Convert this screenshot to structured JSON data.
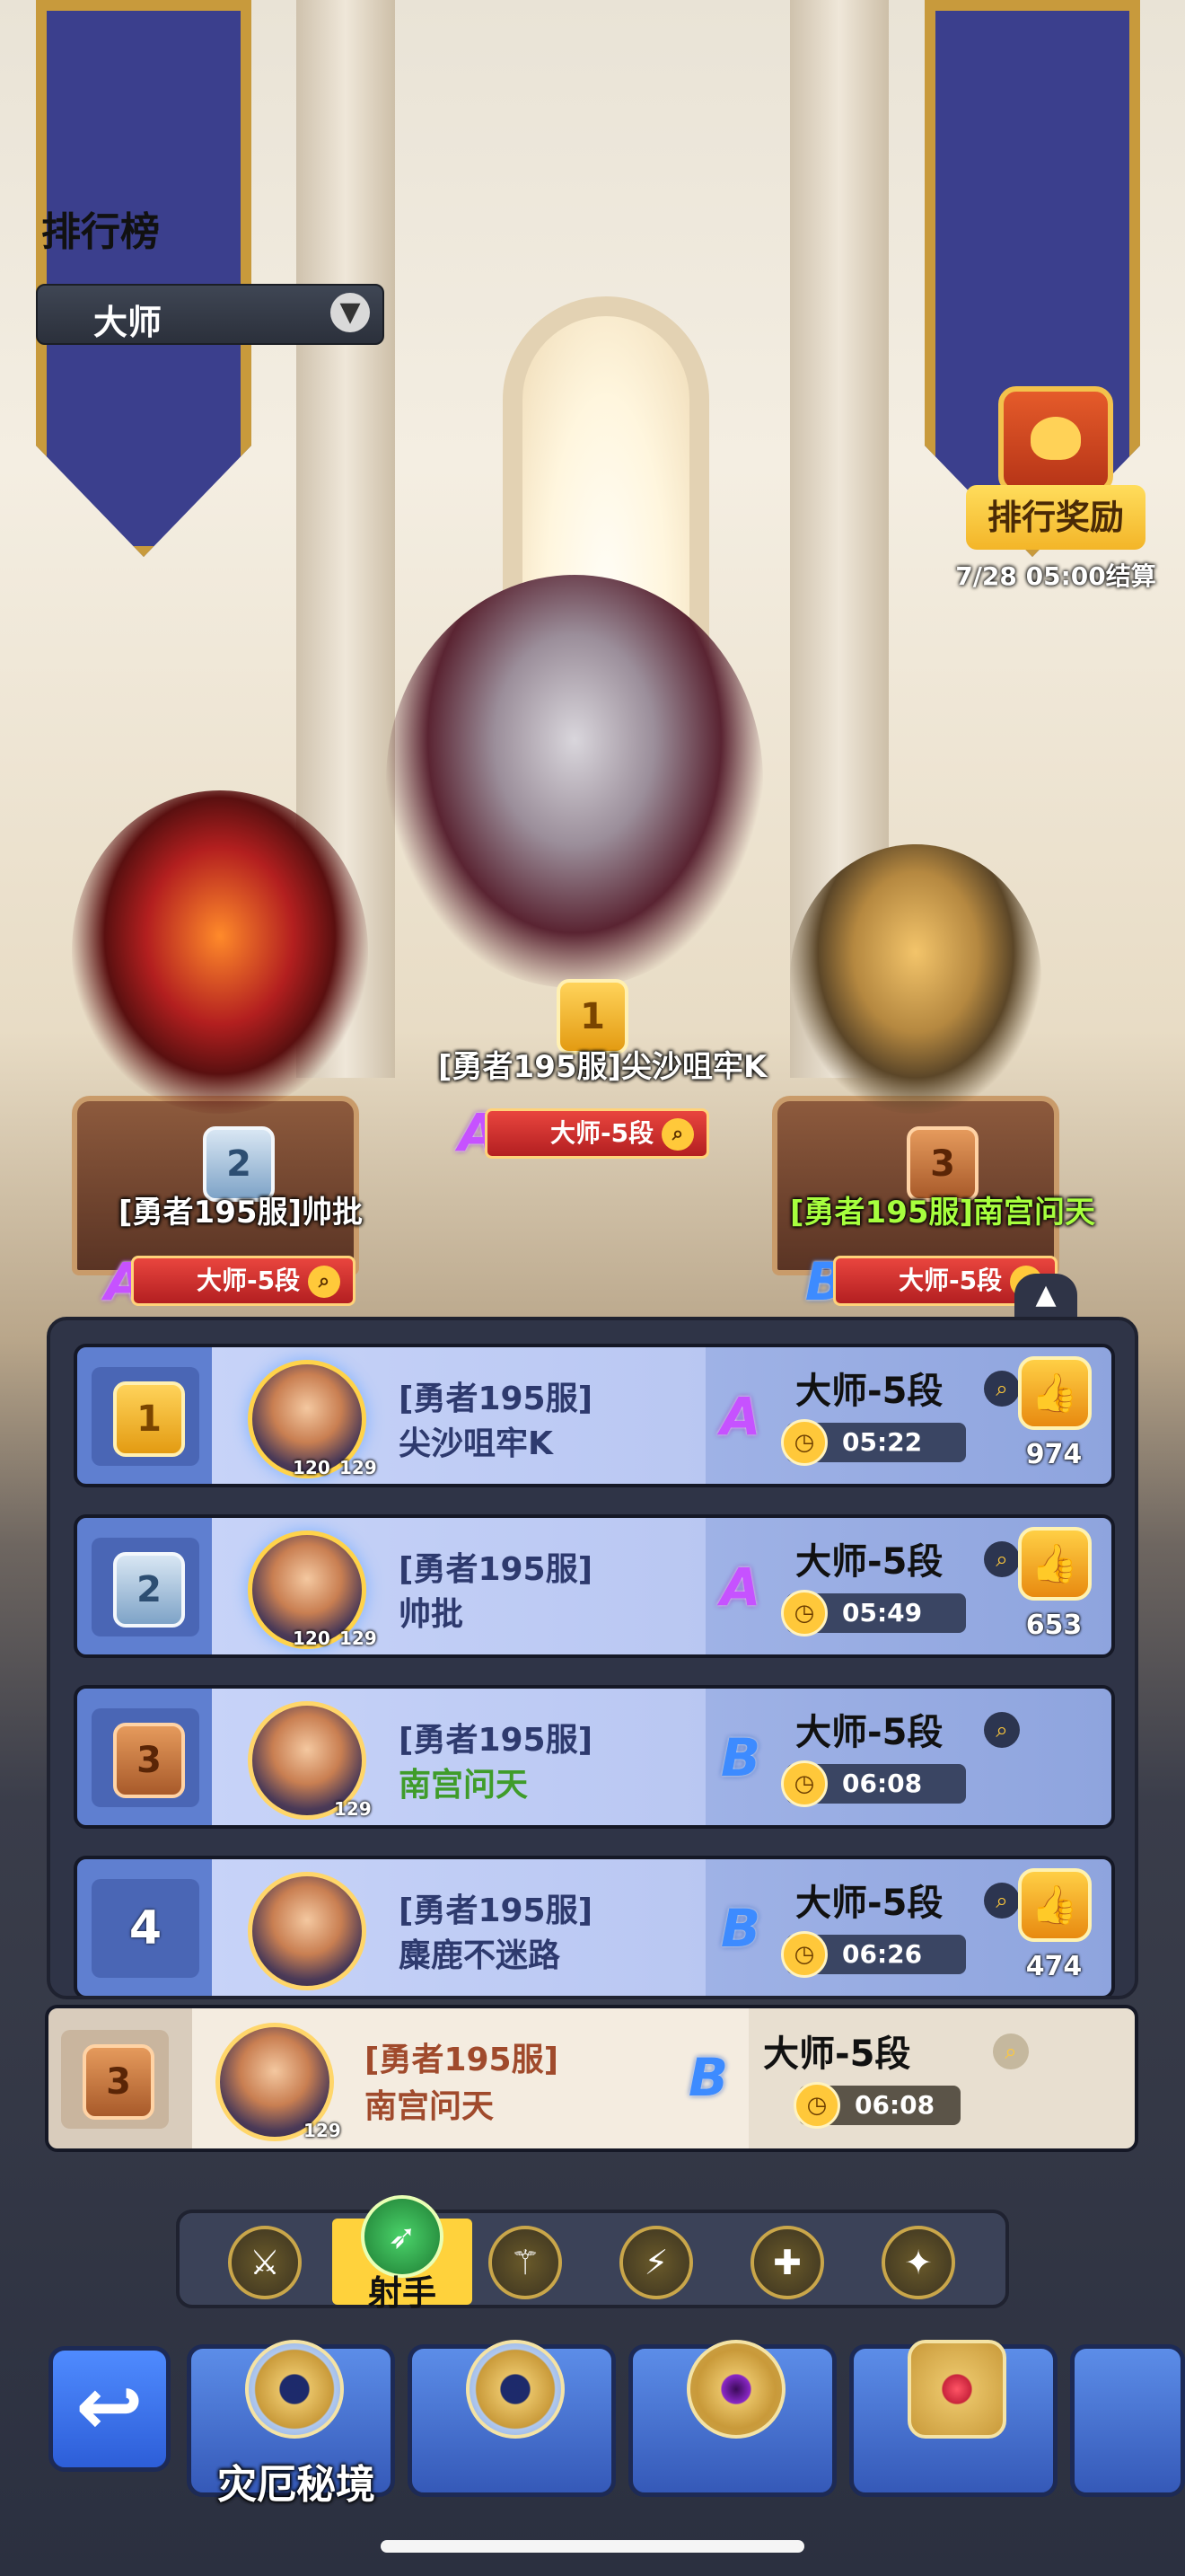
{
  "header": {
    "title": "排行榜",
    "dropdown_value": "大师",
    "dropdown_icon": "chevron-down-icon"
  },
  "reward": {
    "label": "排行奖励",
    "settlement": "7/28 05:00结算"
  },
  "podium": [
    {
      "place": "1",
      "name": "[勇者195服]尖沙咀牢K",
      "grade": "A",
      "tier": "大师-5段"
    },
    {
      "place": "2",
      "name": "[勇者195服]帅批",
      "grade": "A",
      "tier": "大师-5段"
    },
    {
      "place": "3",
      "name": "[勇者195服]南宫问天",
      "grade": "B",
      "tier": "大师-5段"
    }
  ],
  "rows": [
    {
      "rank": "1",
      "server": "[勇者195服]",
      "name": "尖沙咀牢K",
      "level_a": "120",
      "level_b": "129",
      "grade": "A",
      "tier": "大师-5段",
      "time": "05:22",
      "likes": "974"
    },
    {
      "rank": "2",
      "server": "[勇者195服]",
      "name": "帅批",
      "level_a": "120",
      "level_b": "129",
      "grade": "A",
      "tier": "大师-5段",
      "time": "05:49",
      "likes": "653"
    },
    {
      "rank": "3",
      "server": "[勇者195服]",
      "name": "南宫问天",
      "level_b": "129",
      "grade": "B",
      "tier": "大师-5段",
      "time": "06:08"
    },
    {
      "rank": "4",
      "server": "[勇者195服]",
      "name": "麋鹿不迷路",
      "grade": "B",
      "tier": "大师-5段",
      "time": "06:26",
      "likes": "474"
    }
  ],
  "my_rank": {
    "rank": "3",
    "server": "[勇者195服]",
    "name": "南宫问天",
    "level": "129",
    "grade": "B",
    "tier": "大师-5段",
    "time": "06:08"
  },
  "class_filter": {
    "selected_label": "射手",
    "icons": [
      "warrior-icon",
      "archer-icon",
      "mage-icon",
      "assassin-icon",
      "priest-icon",
      "summoner-icon"
    ]
  },
  "modes": {
    "selected_label": "灾厄秘境"
  },
  "colors": {
    "accent_red": "#c62a26",
    "gold": "#ffc93a",
    "row_blue": "#b9c7f2",
    "grade_A": "#c652ff",
    "grade_B": "#3d8bff"
  }
}
